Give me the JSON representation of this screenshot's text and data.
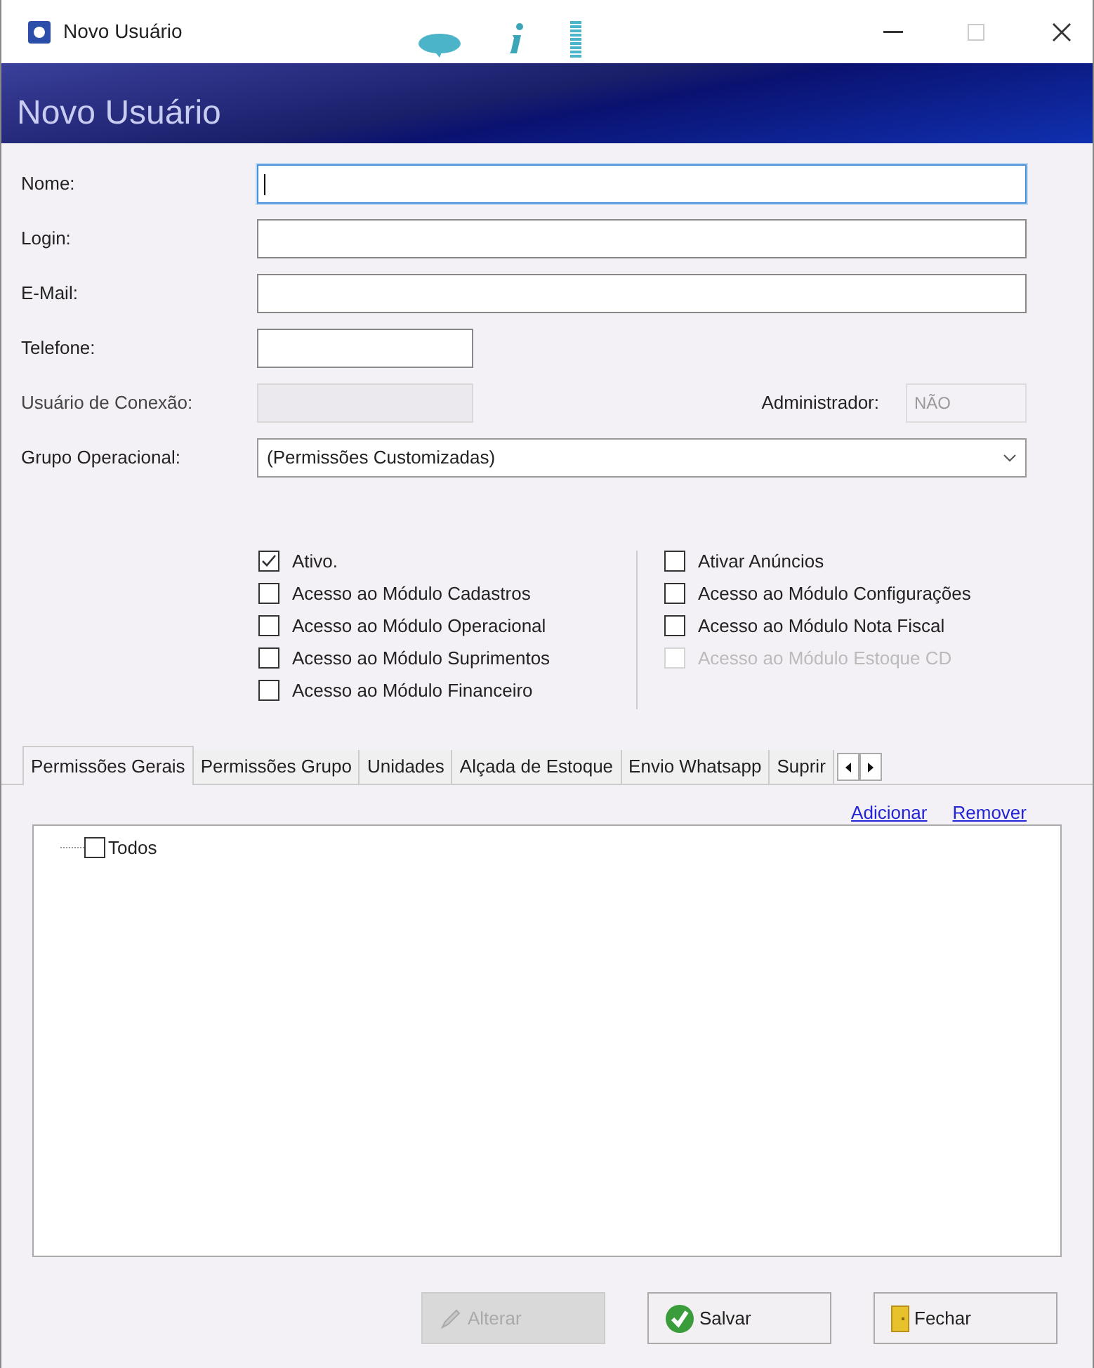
{
  "window": {
    "title": "Novo Usuário"
  },
  "header": {
    "title": "Novo Usuário"
  },
  "fields": [
    {
      "label": "Nome:",
      "kind": "wide",
      "focused": true,
      "disabled": false
    },
    {
      "label": "Login:",
      "kind": "wide",
      "focused": false,
      "disabled": false
    },
    {
      "label": "E-Mail:",
      "kind": "wide",
      "focused": false,
      "disabled": false
    },
    {
      "label": "Telefone:",
      "kind": "short",
      "focused": false,
      "disabled": false
    },
    {
      "label": "Usuário de Conexão:",
      "kind": "short",
      "focused": false,
      "disabled": true,
      "side": {
        "label": "Administrador:",
        "value": "NÃO",
        "disabled": true
      }
    },
    {
      "label": "Grupo Operacional:",
      "kind": "select",
      "value": "(Permissões Customizadas)"
    }
  ],
  "options": [
    [
      {
        "label": "Ativo.",
        "checked": true,
        "disabled": false
      },
      {
        "label": "Acesso ao Módulo Cadastros",
        "checked": false,
        "disabled": false
      },
      {
        "label": "Acesso ao Módulo Operacional",
        "checked": false,
        "disabled": false
      },
      {
        "label": "Acesso ao Módulo Suprimentos",
        "checked": false,
        "disabled": false
      },
      {
        "label": "Acesso ao Módulo Financeiro",
        "checked": false,
        "disabled": false
      }
    ],
    [
      {
        "label": "Ativar Anúncios",
        "checked": false,
        "disabled": false
      },
      {
        "label": "Acesso ao Módulo Configurações",
        "checked": false,
        "disabled": false
      },
      {
        "label": "Acesso ao Módulo Nota Fiscal",
        "checked": false,
        "disabled": false
      },
      {
        "label": "Acesso ao Módulo Estoque CD",
        "checked": false,
        "disabled": true
      }
    ]
  ],
  "tabs": [
    {
      "label": "Permissões Gerais",
      "selected": true
    },
    {
      "label": "Permissões Grupo",
      "selected": false
    },
    {
      "label": "Unidades",
      "selected": false
    },
    {
      "label": "Alçada de Estoque",
      "selected": false
    },
    {
      "label": "Envio Whatsapp",
      "selected": false
    },
    {
      "label": "Suprir",
      "selected": false
    }
  ],
  "links": [
    "Adicionar",
    "Remover"
  ],
  "tree": [
    {
      "label": "Todos",
      "checked": false
    }
  ],
  "buttons": [
    {
      "label": "Alterar",
      "kind": "edit",
      "disabled": true
    },
    {
      "label": "Salvar",
      "kind": "save",
      "disabled": false
    },
    {
      "label": "Fechar",
      "kind": "close",
      "disabled": false
    }
  ]
}
